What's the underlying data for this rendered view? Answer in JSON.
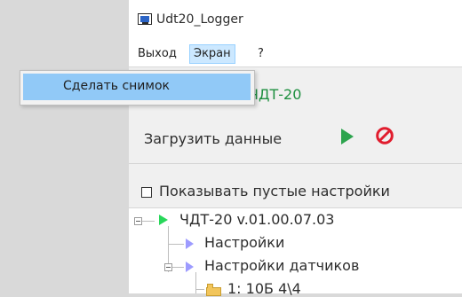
{
  "window": {
    "title": "Udt20_Logger",
    "app_icon": "window-app-icon"
  },
  "menu": {
    "items": [
      {
        "label": "Выход"
      },
      {
        "label": "Экран"
      },
      {
        "label": "?"
      }
    ],
    "dropdown": {
      "items": [
        {
          "label": "Сделать снимок"
        }
      ]
    }
  },
  "device": {
    "title": "ЧДТ-20"
  },
  "toolbar": {
    "load_label": "Загрузить данные",
    "play_icon": "play-icon",
    "stop_icon": "stop-icon",
    "accent_green": "#2da44e",
    "accent_red": "#e11d2e"
  },
  "options": {
    "show_empty_settings_label": "Показывать пустые настройки",
    "show_empty_settings_checked": false
  },
  "tree": {
    "nodes": [
      {
        "label": "ЧДТ-20 v.01.00.07.03",
        "icon": "green-arrow-icon"
      },
      {
        "label": "Настройки",
        "icon": "blue-arrow-icon"
      },
      {
        "label": "Настройки датчиков",
        "icon": "blue-arrow-icon"
      },
      {
        "label": "1: 10Б 4\\4",
        "icon": "folder-icon"
      }
    ]
  }
}
